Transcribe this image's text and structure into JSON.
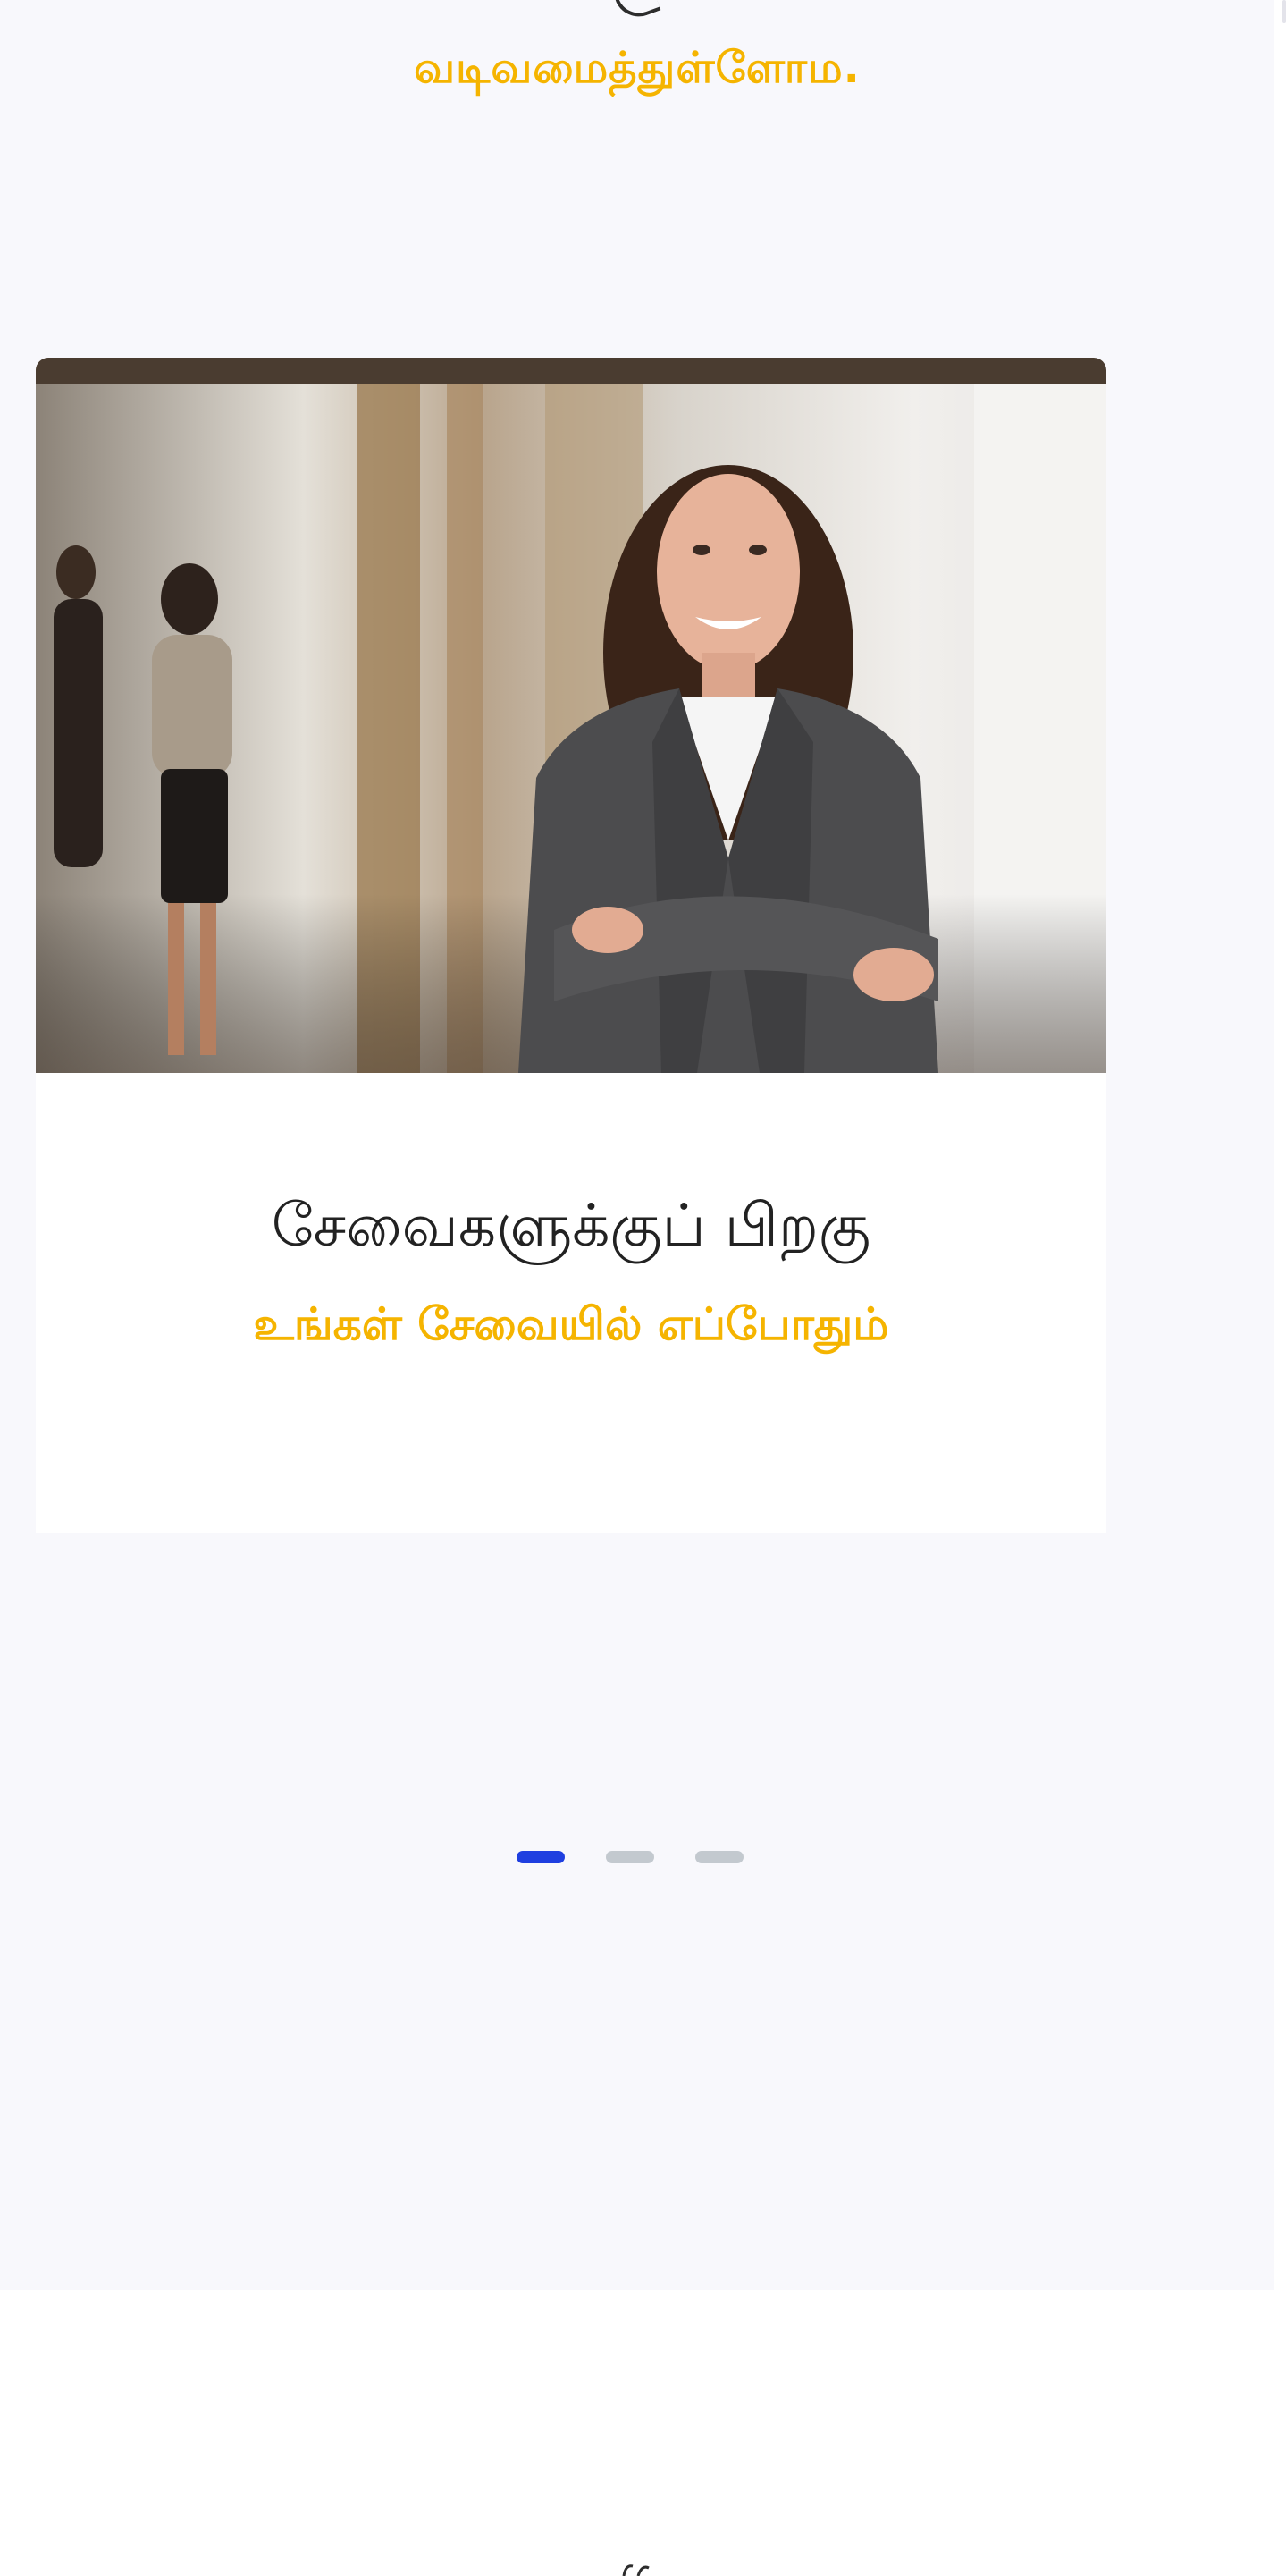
{
  "heading": {
    "tail": "வடிவமைத்துள்ளோம."
  },
  "carousel": {
    "slides": [
      {
        "title": "சேவைகளுக்குப் பிறகு",
        "subtitle": "உங்கள் சேவையில் எப்போதும்"
      }
    ],
    "active_index": 0,
    "slide_count": 3
  },
  "colors": {
    "accent": "#f5b400",
    "indicator_active": "#1f3fe0",
    "indicator_inactive": "#c3c9cf",
    "section_bg": "#f8f8fc"
  }
}
